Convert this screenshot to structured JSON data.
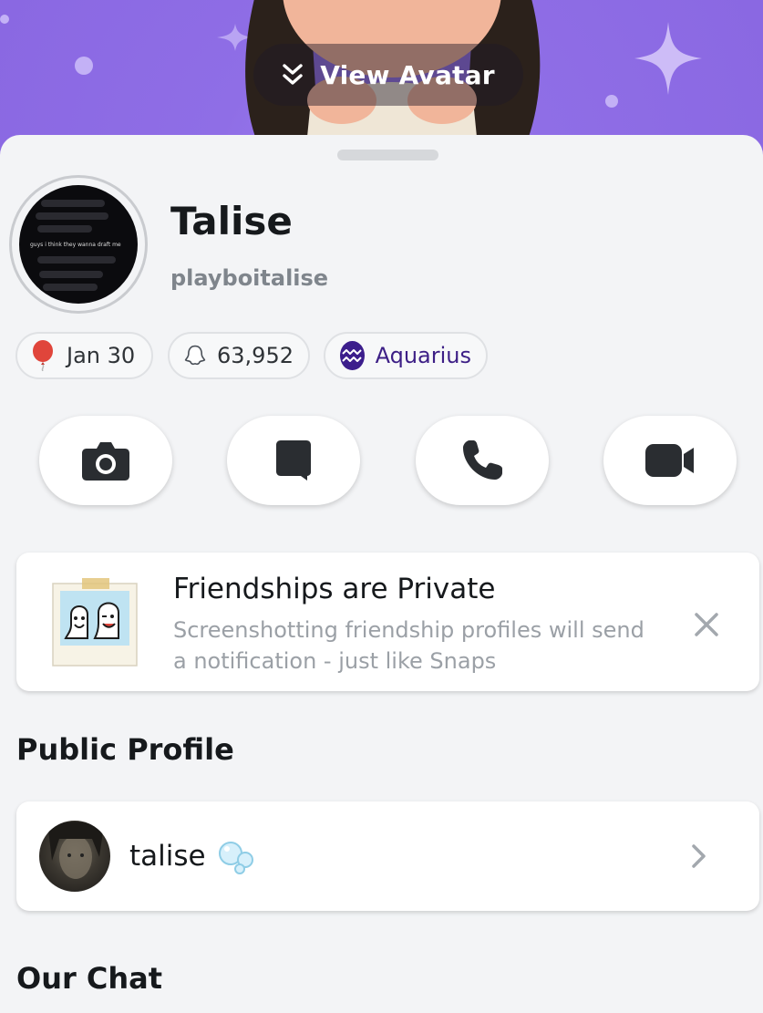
{
  "header": {
    "view_avatar_label": "View Avatar",
    "bg_color": "#8a68e2"
  },
  "profile": {
    "display_name": "Talise",
    "username": "playboitalise",
    "pfp_caption": "guys i think they wanna draft me"
  },
  "chips": {
    "birthday": {
      "icon": "balloon-icon",
      "label": "Jan 30"
    },
    "snapscore": {
      "icon": "ghost-icon",
      "label": "63,952"
    },
    "zodiac": {
      "icon": "aquarius-icon",
      "label": "Aquarius"
    }
  },
  "actions": [
    {
      "name": "camera-button",
      "icon": "camera-icon"
    },
    {
      "name": "chat-button",
      "icon": "chat-bubble-icon"
    },
    {
      "name": "voice-call-button",
      "icon": "phone-icon"
    },
    {
      "name": "video-call-button",
      "icon": "video-camera-icon"
    }
  ],
  "notice": {
    "title": "Friendships are Private",
    "body": "Screenshotting friendship profiles will send a notification - just like Snaps"
  },
  "public_profile": {
    "section_title": "Public Profile",
    "name": "talise",
    "emoji": "bubbles-emoji"
  },
  "our_chat": {
    "section_title": "Our Chat"
  },
  "colors": {
    "accent_purple": "#3c1e8c",
    "balloon_red": "#e0453b"
  }
}
